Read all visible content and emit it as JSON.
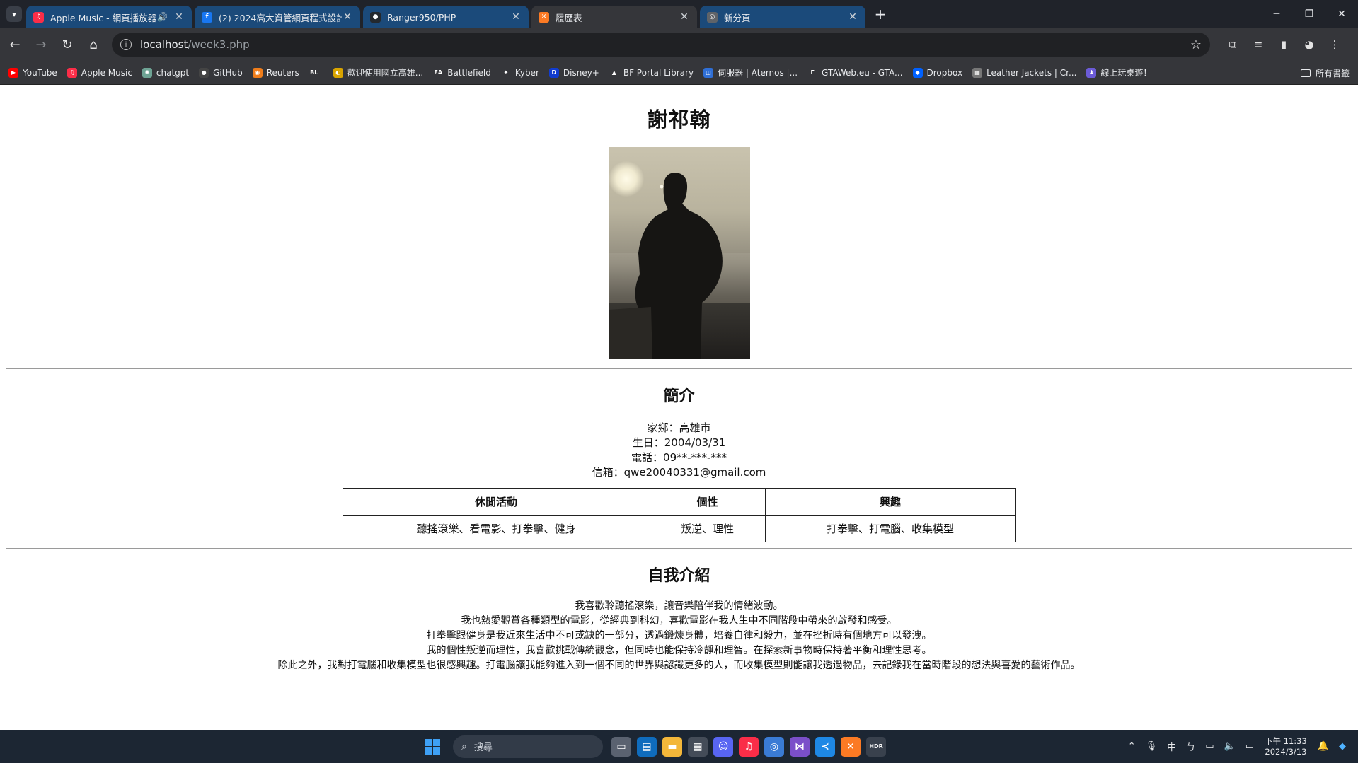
{
  "browser": {
    "tabs": [
      {
        "title": "Apple Music - 網頁播放器",
        "favicon": "apple-music-icon",
        "color": "#fa2d48",
        "glyph": "♫",
        "audio": true,
        "active": false
      },
      {
        "title": "(2) 2024高大資管網頁程式設計",
        "favicon": "facebook-icon",
        "color": "#1877f2",
        "glyph": "f",
        "audio": false,
        "active": false
      },
      {
        "title": "Ranger950/PHP",
        "favicon": "github-icon",
        "color": "#24292e",
        "glyph": "●",
        "audio": false,
        "active": false
      },
      {
        "title": "履歷表",
        "favicon": "xampp-icon",
        "color": "#fb7a24",
        "glyph": "✕",
        "audio": false,
        "active": true
      },
      {
        "title": "新分頁",
        "favicon": "chrome-icon",
        "color": "#5f6368",
        "glyph": "◎",
        "audio": false,
        "active": false
      }
    ],
    "url_host": "localhost",
    "url_path": "/week3.php",
    "bookmarks": [
      {
        "label": "YouTube",
        "icon": "youtube-icon",
        "color": "#ff0000",
        "glyph": "▶"
      },
      {
        "label": "Apple Music",
        "icon": "apple-music-icon",
        "color": "#fa2d48",
        "glyph": "♫"
      },
      {
        "label": "chatgpt",
        "icon": "chatgpt-icon",
        "color": "#6ea394",
        "glyph": "✺"
      },
      {
        "label": "GitHub",
        "icon": "github-icon",
        "color": "#444",
        "glyph": "●"
      },
      {
        "label": "Reuters",
        "icon": "reuters-icon",
        "color": "#f07d1a",
        "glyph": "◉"
      },
      {
        "label": "",
        "icon": "bl-icon",
        "color": "#35363a",
        "glyph": "BL"
      },
      {
        "label": "歡迎使用國立高雄...",
        "icon": "university-icon",
        "color": "#d9a400",
        "glyph": "◐"
      },
      {
        "label": "Battlefield",
        "icon": "ea-icon",
        "color": "#35363a",
        "glyph": "EA"
      },
      {
        "label": "Kyber",
        "icon": "kyber-icon",
        "color": "#35363a",
        "glyph": "✦"
      },
      {
        "label": "Disney+",
        "icon": "disney-icon",
        "color": "#113ccf",
        "glyph": "D"
      },
      {
        "label": "BF Portal Library",
        "icon": "bf-portal-icon",
        "color": "#35363a",
        "glyph": "▲"
      },
      {
        "label": "伺服器 | Aternos |...",
        "icon": "aternos-icon",
        "color": "#2f6fd6",
        "glyph": "◫"
      },
      {
        "label": "GTAWeb.eu - GTA...",
        "icon": "gtaweb-icon",
        "color": "#35363a",
        "glyph": "Γ"
      },
      {
        "label": "Dropbox",
        "icon": "dropbox-icon",
        "color": "#0061ff",
        "glyph": "◆"
      },
      {
        "label": "Leather Jackets | Cr...",
        "icon": "leather-jacket-icon",
        "color": "#777",
        "glyph": "▦"
      },
      {
        "label": "線上玩桌遊！",
        "icon": "board-game-icon",
        "color": "#6b5bd6",
        "glyph": "♟"
      }
    ],
    "all_bookmarks_label": "所有書籤",
    "window_controls": {
      "minimize": "─",
      "restore": "❐",
      "close": "✕"
    }
  },
  "page": {
    "name": "謝祁翰",
    "intro_title": "簡介",
    "info": [
      {
        "label": "家鄉：",
        "value": "高雄市"
      },
      {
        "label": "生日：",
        "value": "2004/03/31"
      },
      {
        "label": "電話：",
        "value": "09**-***-***"
      },
      {
        "label": "信箱：",
        "value": "qwe20040331@gmail.com"
      }
    ],
    "table": {
      "headers": [
        "休閒活動",
        "個性",
        "興趣"
      ],
      "row": [
        "聽搖滾樂、看電影、打拳擊、健身",
        "叛逆、理性",
        "打拳擊、打電腦、收集模型"
      ]
    },
    "bio_title": "自我介紹",
    "bio_lines": [
      "我喜歡聆聽搖滾樂，讓音樂陪伴我的情緒波動。",
      "我也熱愛觀賞各種類型的電影，從經典到科幻，喜歡電影在我人生中不同階段中帶來的啟發和感受。",
      "打拳擊跟健身是我近來生活中不可或缺的一部分，透過鍛煉身體，培養自律和毅力，並在挫折時有個地方可以發洩。",
      "我的個性叛逆而理性，我喜歡挑戰傳統觀念，但同時也能保持冷靜和理智。在探索新事物時保持著平衡和理性思考。",
      "除此之外，我對打電腦和收集模型也很感興趣。打電腦讓我能夠進入到一個不同的世界與認識更多的人，而收集模型則能讓我透過物品，去記錄我在當時階段的想法與喜愛的藝術作品。"
    ]
  },
  "taskbar": {
    "search_placeholder": "搜尋",
    "apps": [
      {
        "name": "task-view-icon",
        "color": "#5a6270",
        "glyph": "▭"
      },
      {
        "name": "store-icon",
        "color": "#0f6cbd",
        "glyph": "▤"
      },
      {
        "name": "file-explorer-icon",
        "color": "#f3b73a",
        "glyph": "▬"
      },
      {
        "name": "photo-app-icon",
        "color": "#444c58",
        "glyph": "▦"
      },
      {
        "name": "discord-icon",
        "color": "#5865f2",
        "glyph": "☺"
      },
      {
        "name": "apple-music-icon",
        "color": "#fa2d48",
        "glyph": "♫"
      },
      {
        "name": "chrome-icon",
        "color": "#3a7bd5",
        "glyph": "◎"
      },
      {
        "name": "visual-studio-icon",
        "color": "#7b4fc9",
        "glyph": "⋈"
      },
      {
        "name": "vscode-icon",
        "color": "#1e88e5",
        "glyph": "≺"
      },
      {
        "name": "xampp-icon",
        "color": "#fb7a24",
        "glyph": "✕"
      },
      {
        "name": "hdr-icon",
        "color": "#39414d",
        "glyph": "HDR"
      }
    ],
    "input_method": "中",
    "time": "下午 11:33",
    "date": "2024/3/13"
  }
}
